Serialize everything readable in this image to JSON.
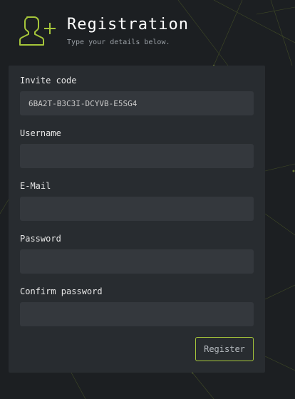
{
  "header": {
    "icon": "add-user-icon",
    "title": "Registration",
    "subtitle": "Type your details below."
  },
  "form": {
    "invite": {
      "label": "Invite code",
      "value": "6BA2T-B3C3I-DCYVB-E5SG4"
    },
    "username": {
      "label": "Username",
      "value": ""
    },
    "email": {
      "label": "E-Mail",
      "value": ""
    },
    "password": {
      "label": "Password",
      "value": ""
    },
    "confirm": {
      "label": "Confirm password",
      "value": ""
    },
    "register_label": "Register"
  },
  "colors": {
    "background": "#1c1f22",
    "card": "#282c30",
    "input": "#34383d",
    "accent": "#a5c53a"
  }
}
